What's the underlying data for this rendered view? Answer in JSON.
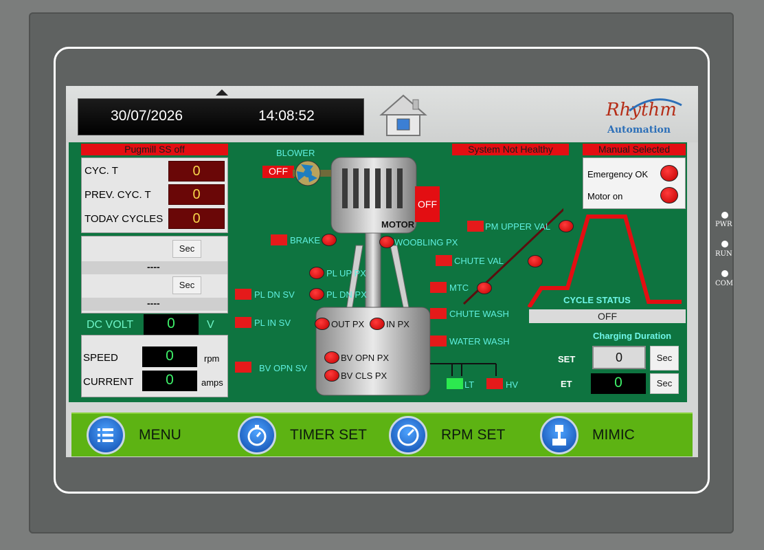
{
  "header": {
    "date": "30/07/2026",
    "time": "14:08:52"
  },
  "logo": {
    "line1": "Rhythm",
    "line2": "Automation"
  },
  "status": {
    "pugmill": "Pugmill SS off",
    "system": "System Not Healthy",
    "mode": "Manual Selected"
  },
  "cycles": {
    "cyc_t_label": "CYC. T",
    "cyc_t": "0",
    "prev_label": "PREV. CYC. T",
    "prev": "0",
    "today_label": "TODAY CYCLES",
    "today": "0"
  },
  "timers": {
    "sec1": "Sec",
    "dash1": "----",
    "sec2": "Sec",
    "dash2": "----"
  },
  "dc": {
    "label": "DC VOLT",
    "value": "0",
    "unit": "V"
  },
  "drive": {
    "speed_label": "SPEED",
    "speed": "0",
    "speed_unit": "rpm",
    "current_label": "CURRENT",
    "current": "0",
    "current_unit": "amps"
  },
  "mimic": {
    "blower": "BLOWER",
    "blower_state": "OFF",
    "motor": "MOTOR",
    "motor_state": "OFF",
    "brake": "BRAKE",
    "woobling": "WOOBLING PX",
    "pm_upper": "PM UPPER VAL",
    "chute_val": "CHUTE VAL",
    "pl_up_px": "PL UP PX",
    "pl_dn_sv": "PL DN SV",
    "pl_dn_px": "PL DN PX",
    "mtc": "MTC",
    "chute_wash": "CHUTE WASH",
    "pl_in_sv": "PL IN SV",
    "out_px": "OUT PX",
    "in_px": "IN PX",
    "water_wash": "WATER WASH",
    "bv_opn_sv": "BV OPN SV",
    "bv_opn_px": "BV OPN PX",
    "bv_cls_px": "BV CLS PX",
    "lt": "LT",
    "hv": "HV"
  },
  "indicators": {
    "emergency": "Emergency OK",
    "motor_on": "Motor on"
  },
  "cycle": {
    "label": "CYCLE STATUS",
    "status": "OFF"
  },
  "charging": {
    "label": "Charging Duration",
    "set_label": "SET",
    "set_value": "0",
    "set_unit": "Sec",
    "et_label": "ET",
    "et_value": "0",
    "et_unit": "Sec"
  },
  "menu": {
    "menu": "MENU",
    "timer": "TIMER SET",
    "rpm": "RPM SET",
    "mimic": "MIMIC"
  },
  "leds": {
    "pwr": "PWR",
    "run": "RUN",
    "com": "COM"
  },
  "colors": {
    "accent_green": "#0e7440",
    "alarm_red": "#e30e12",
    "menu_green": "#5db313"
  }
}
